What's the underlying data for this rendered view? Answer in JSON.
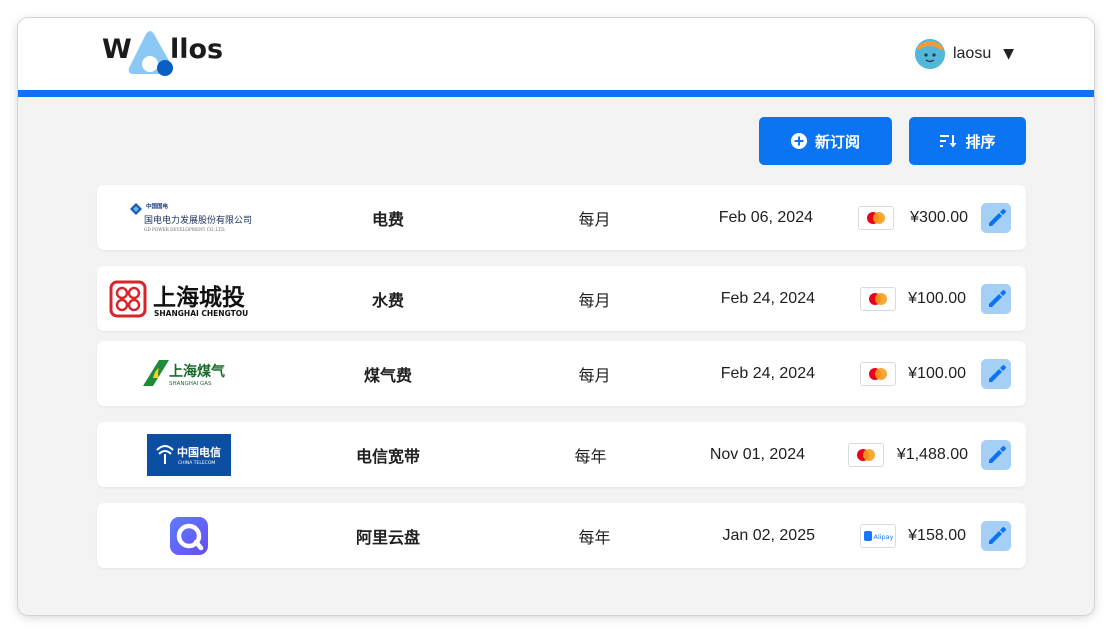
{
  "brand": {
    "w": "W",
    "rest": "llos"
  },
  "user": {
    "name": "laosu",
    "caret": "▼"
  },
  "toolbar": {
    "add_label": "新订阅",
    "sort_label": "排序"
  },
  "subscriptions": [
    {
      "logo_text": [
        "中国国电",
        "国电电力发展股份有限公司",
        "GD POWER DEVELOPMENT CO.,LTD."
      ],
      "name": "电费",
      "cycle": "每月",
      "next_payment": "Feb 06, 2024",
      "payment_method": "mastercard-icon",
      "price": "¥300.00"
    },
    {
      "logo_text": [
        "上海城投",
        "SHANGHAI CHENGTOU"
      ],
      "name": "水费",
      "cycle": "每月",
      "next_payment": "Feb 24, 2024",
      "payment_method": "mastercard-icon",
      "price": "¥100.00"
    },
    {
      "logo_text": [
        "上海煤气",
        "SHANGHAI GAS"
      ],
      "name": "煤气费",
      "cycle": "每月",
      "next_payment": "Feb 24, 2024",
      "payment_method": "mastercard-icon",
      "price": "¥100.00"
    },
    {
      "logo_text": [
        "中国电信",
        "CHINA TELECOM"
      ],
      "name": "电信宽带",
      "cycle": "每年",
      "next_payment": "Nov 01, 2024",
      "payment_method": "mastercard-icon",
      "price": "¥1,488.00"
    },
    {
      "logo_text": [],
      "name": "阿里云盘",
      "cycle": "每年",
      "next_payment": "Jan 02, 2025",
      "payment_method": "alipay-icon",
      "payment_label": "Alipay",
      "price": "¥158.00"
    }
  ],
  "colors": {
    "accent": "#0a74f2",
    "edit_bg": "#a6cff5",
    "background": "#f3f3f3"
  }
}
